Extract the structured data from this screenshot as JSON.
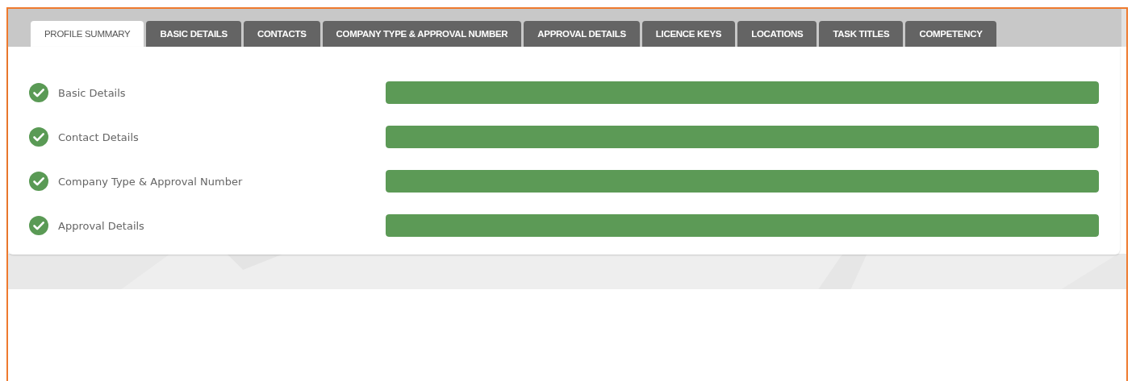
{
  "tabs": [
    {
      "label": "PROFILE SUMMARY",
      "selected": true
    },
    {
      "label": "BASIC DETAILS",
      "selected": false
    },
    {
      "label": "CONTACTS",
      "selected": false
    },
    {
      "label": "COMPANY TYPE & APPROVAL NUMBER",
      "selected": false
    },
    {
      "label": "APPROVAL DETAILS",
      "selected": false
    },
    {
      "label": "LICENCE KEYS",
      "selected": false
    },
    {
      "label": "LOCATIONS",
      "selected": false
    },
    {
      "label": "TASK TITLES",
      "selected": false
    },
    {
      "label": "COMPETENCY",
      "selected": false
    }
  ],
  "sections": [
    {
      "name": "Basic Details",
      "complete": true,
      "level": 1
    },
    {
      "name": "Contact Details",
      "complete": true,
      "level": 1
    },
    {
      "name": "Company Type & Approval Number",
      "complete": true,
      "level": 1
    },
    {
      "name": "Approval Details",
      "complete": true,
      "level": 1
    }
  ]
}
